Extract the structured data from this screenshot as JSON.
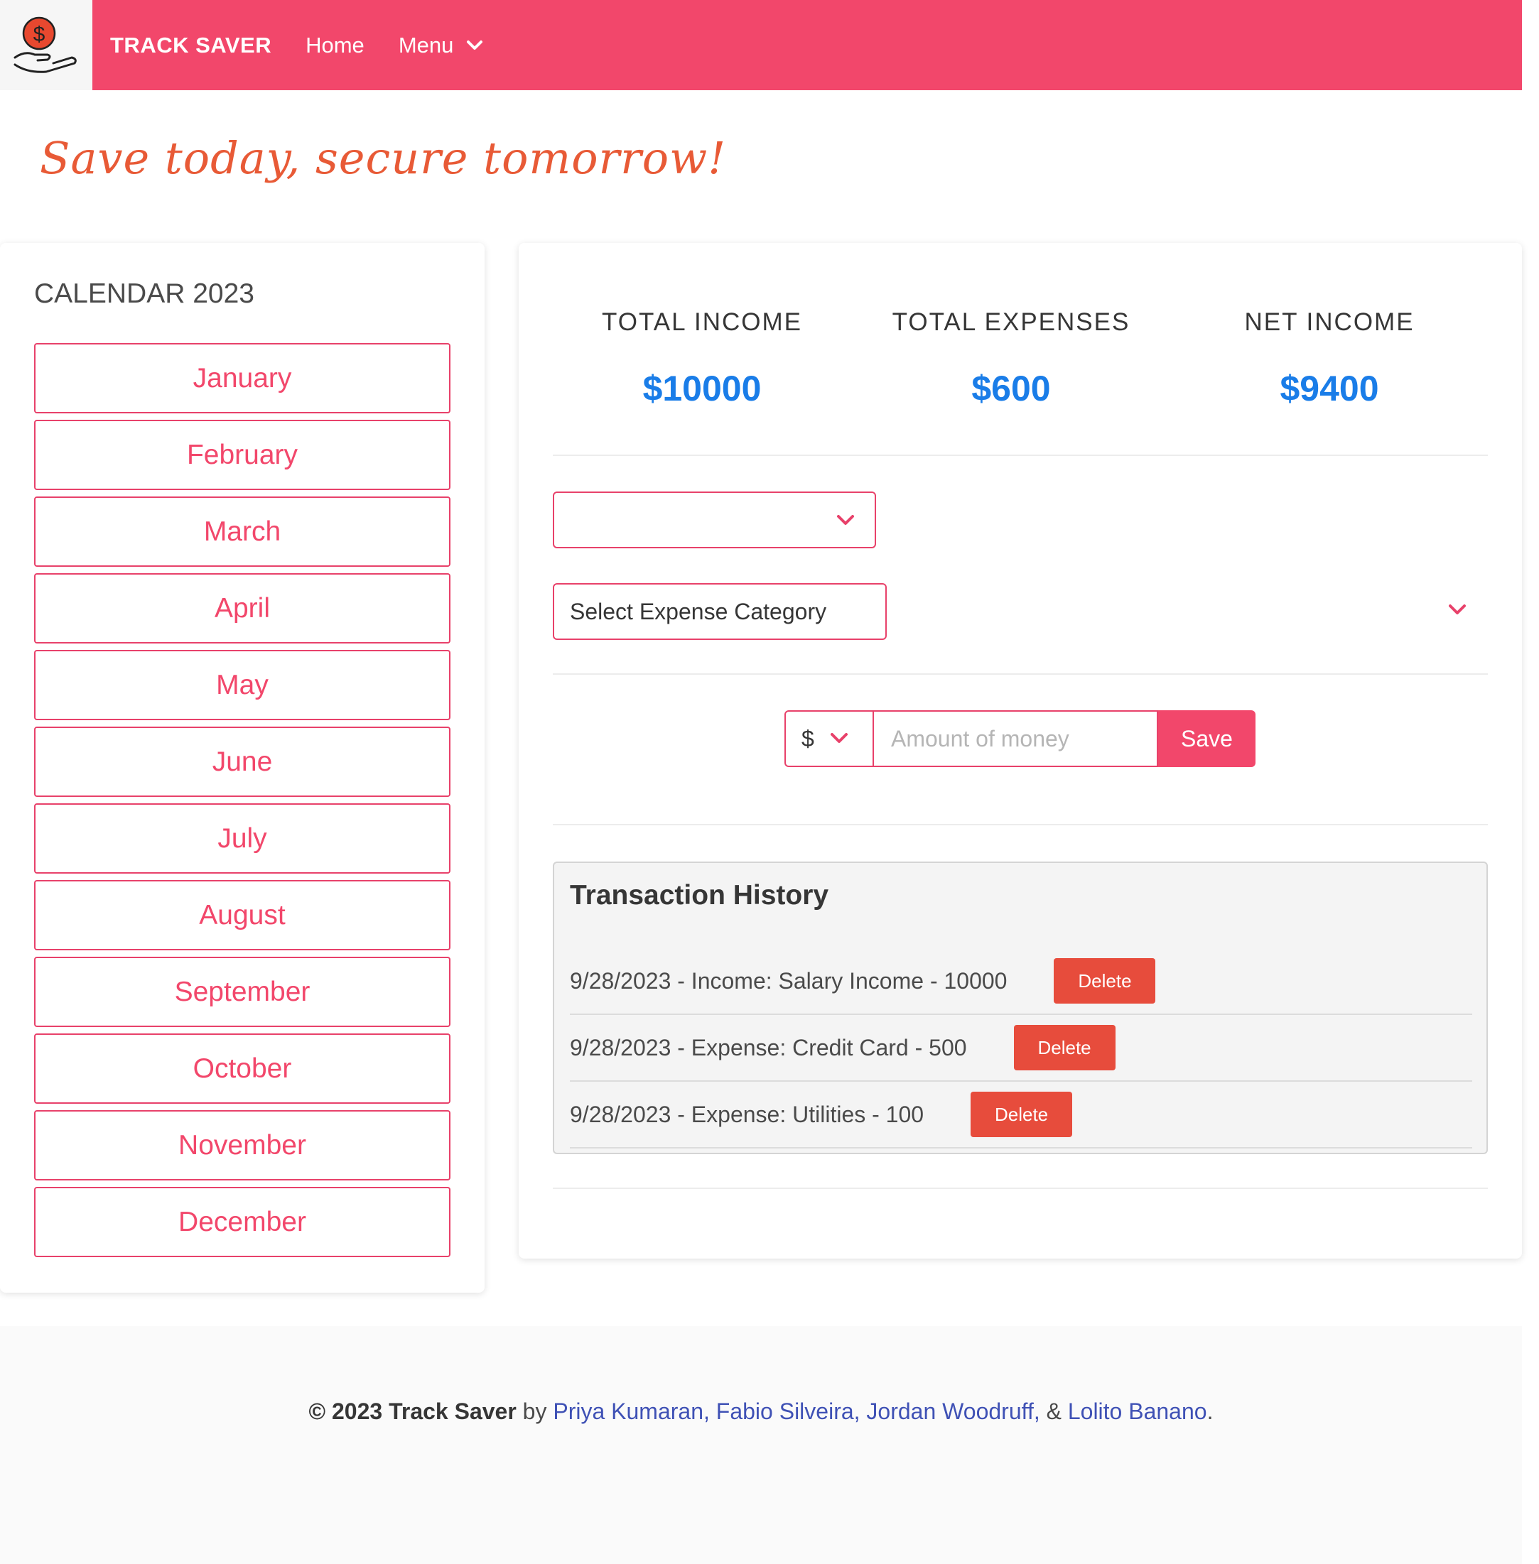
{
  "nav": {
    "brand": "TRACK SAVER",
    "home": "Home",
    "menu": "Menu"
  },
  "tagline": "Save today, secure tomorrow!",
  "calendar": {
    "title": "CALENDAR 2023",
    "months": [
      "January",
      "February",
      "March",
      "April",
      "May",
      "June",
      "July",
      "August",
      "September",
      "October",
      "November",
      "December"
    ]
  },
  "stats": {
    "total_income_label": "TOTAL INCOME",
    "total_income_value": "$10000",
    "total_expenses_label": "TOTAL EXPENSES",
    "total_expenses_value": "$600",
    "net_income_label": "NET INCOME",
    "net_income_value": "$9400"
  },
  "form": {
    "type_select_value": "",
    "category_select_value": "Select Expense Category",
    "currency": "$",
    "amount_placeholder": "Amount of money",
    "save_label": "Save"
  },
  "history": {
    "title": "Transaction History",
    "delete_label": "Delete",
    "items": [
      "9/28/2023 - Income: Salary Income - 10000",
      "9/28/2023 - Expense: Credit Card - 500",
      "9/28/2023 - Expense: Utilities - 100"
    ]
  },
  "footer": {
    "copyright": "© 2023 Track Saver",
    "by": "by",
    "author1": "Priya Kumaran,",
    "author2": "Fabio Silveira,",
    "author3": "Jordan Woodruff,",
    "amp": "&",
    "author4": "Lolito Banano",
    "period": "."
  },
  "colors": {
    "brand": "#f2476b",
    "accent_blue": "#1a7de8",
    "delete": "#e74c3c",
    "tagline": "#e85a36"
  }
}
